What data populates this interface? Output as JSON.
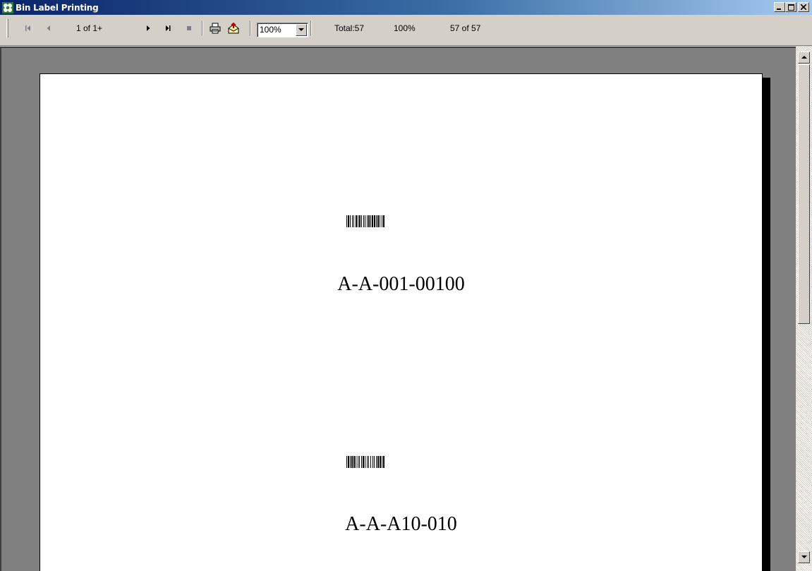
{
  "window": {
    "title": "Bin Label Printing",
    "minimize_icon": "minimize-icon",
    "maximize_icon": "maximize-icon",
    "close_icon": "close-icon"
  },
  "toolbar": {
    "page_indicator": "1 of 1+",
    "zoom": {
      "selected": "100%"
    },
    "total": "Total:57",
    "percent": "100%",
    "records": "57 of 57",
    "icons": [
      "first-page-icon",
      "previous-page-icon",
      "next-page-icon",
      "last-page-icon",
      "stop-icon",
      "print-icon",
      "export-icon",
      "dropdown-arrow-icon"
    ]
  },
  "report": {
    "labels": [
      {
        "code": "A-A-001-00100"
      },
      {
        "code": "A-A-A10-010"
      }
    ]
  }
}
